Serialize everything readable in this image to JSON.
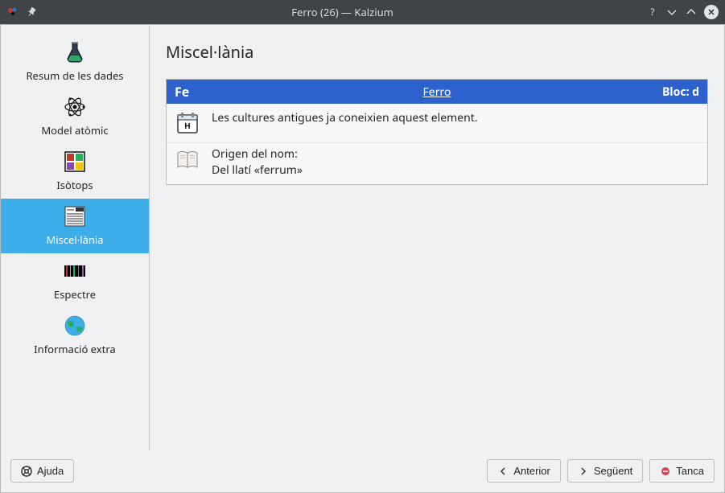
{
  "titlebar": {
    "title": "Ferro (26) — Kalzium"
  },
  "sidebar": {
    "items": [
      {
        "label": "Resum de les dades",
        "name": "sidebar-item-summary"
      },
      {
        "label": "Model atòmic",
        "name": "sidebar-item-atomic-model"
      },
      {
        "label": "Isòtops",
        "name": "sidebar-item-isotopes"
      },
      {
        "label": "Miscel·lània",
        "name": "sidebar-item-misc"
      },
      {
        "label": "Espectre",
        "name": "sidebar-item-spectrum"
      },
      {
        "label": "Informació extra",
        "name": "sidebar-item-extra-info"
      }
    ],
    "selectedIndex": 3
  },
  "main": {
    "title": "Miscel·lània",
    "element": {
      "symbol": "Fe",
      "name": "Ferro",
      "block_label": "Bloc: d"
    },
    "rows": [
      {
        "icon": "calendar-icon",
        "text1": "Les cultures antigues ja coneixien aquest element.",
        "text2": ""
      },
      {
        "icon": "book-icon",
        "text1": "Origen del nom:",
        "text2": "Del llatí «ferrum»"
      }
    ]
  },
  "footer": {
    "help": "Ajuda",
    "prev": "Anterior",
    "next": "Següent",
    "close": "Tanca"
  }
}
